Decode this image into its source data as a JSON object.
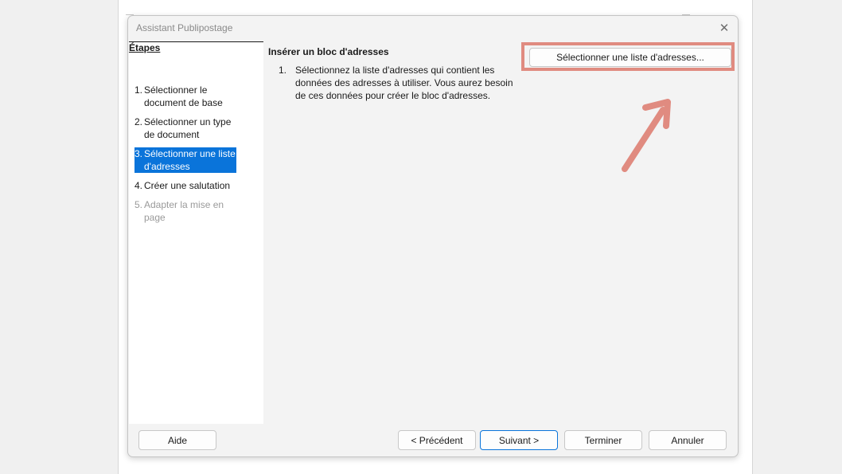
{
  "window": {
    "title": "Assistant Publipostage"
  },
  "steps": {
    "heading": "Étapes",
    "items": [
      {
        "number": "1.",
        "label": "Sélectionner le document de base",
        "state": "normal"
      },
      {
        "number": "2.",
        "label": "Sélectionner un type de document",
        "state": "normal"
      },
      {
        "number": "3.",
        "label": "Sélectionner une liste d'adresses",
        "state": "active"
      },
      {
        "number": "4.",
        "label": "Créer une salutation",
        "state": "normal"
      },
      {
        "number": "5.",
        "label": "Adapter la mise en page",
        "state": "disabled"
      }
    ]
  },
  "content": {
    "section_title": "Insérer un bloc d'adresses",
    "instruction_number": "1.",
    "instruction_text": "Sélectionnez la liste d'adresses qui contient les données des adresses à utiliser. Vous aurez besoin de ces données pour créer le bloc d'adresses.",
    "select_button_label": "Sélectionner une liste d'adresses..."
  },
  "footer": {
    "help_label": "Aide",
    "back_label": "< Précédent",
    "next_label": "Suivant >",
    "finish_label": "Terminer",
    "cancel_label": "Annuler"
  },
  "colors": {
    "accent": "#0a74da",
    "annotation": "#e08b80"
  },
  "icons": {
    "close": "close-icon",
    "annotation_arrow": "arrow-icon"
  }
}
